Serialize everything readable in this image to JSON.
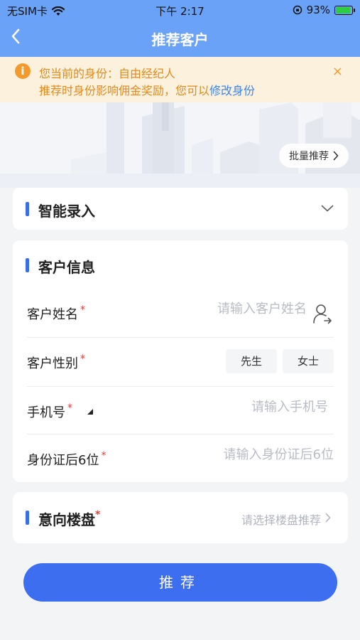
{
  "status_bar": {
    "carrier": "无SIM卡",
    "time": "下午 2:17",
    "battery": "93%"
  },
  "nav": {
    "title": "推荐客户"
  },
  "notice": {
    "line1": "您当前的身份：自由经纪人",
    "line2_prefix": "推荐时身份影响佣金奖励，您可以",
    "line2_link": "修改身份",
    "info_icon": "i",
    "close_icon": "×"
  },
  "hero": {
    "batch_label": "批量推荐"
  },
  "smart_entry": {
    "title": "智能录入"
  },
  "customer_info": {
    "title": "客户信息",
    "name_label": "客户姓名",
    "name_placeholder": "请输入客户姓名",
    "gender_label": "客户性别",
    "gender_options": [
      "先生",
      "女士"
    ],
    "phone_label": "手机号",
    "phone_placeholder": "请输入手机号",
    "id_label": "身份证后6位",
    "id_placeholder": "请输入身份证后6位",
    "required_mark": "*"
  },
  "property": {
    "title": "意向楼盘",
    "placeholder": "请选择楼盘推荐"
  },
  "submit_label": "推荐",
  "colors": {
    "header": "#6aa2f7",
    "accent": "#3d6ef0",
    "notice_bg": "#fcf1dd",
    "notice_text": "#e08a1e",
    "required": "#e23b3b"
  }
}
